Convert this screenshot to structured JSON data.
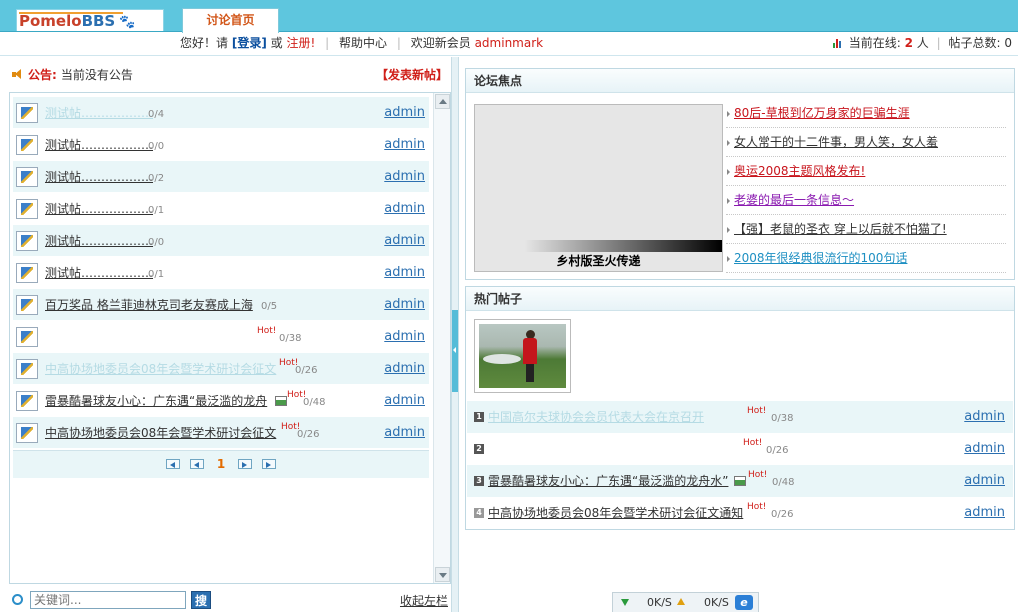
{
  "header": {
    "logo_a": "Pomelo",
    "logo_b": "BBS",
    "active_tab": "讨论首页"
  },
  "nav": {
    "greeting": "您好！请",
    "login": "[登录]",
    "or": "或",
    "register": "注册!",
    "help": "帮助中心",
    "welcome": "欢迎新会员",
    "new_member": "adminmark",
    "online_label": "当前在线:",
    "online_count": "2",
    "online_unit": "人",
    "total_label": "帖子总数:",
    "total_count": "0"
  },
  "notice": {
    "label": "公告:",
    "text": "当前没有公告",
    "post_button": "【发表新帖】"
  },
  "threads": [
    {
      "title": "测试帖………………",
      "count": "0/4",
      "hot": false,
      "author": "admin",
      "faded": true
    },
    {
      "title": "测试帖………………",
      "count": "0/0",
      "hot": false,
      "author": "admin",
      "faded": false
    },
    {
      "title": "测试帖………………",
      "count": "0/2",
      "hot": false,
      "author": "admin",
      "faded": false
    },
    {
      "title": "测试帖………………",
      "count": "0/1",
      "hot": false,
      "author": "admin",
      "faded": false
    },
    {
      "title": "测试帖………………",
      "count": "0/0",
      "hot": false,
      "author": "admin",
      "faded": false
    },
    {
      "title": "测试帖………………",
      "count": "0/1",
      "hot": false,
      "author": "admin",
      "faded": false
    },
    {
      "title": "百万奖品 格兰菲迪林克司老友赛成上海",
      "count": "0/5",
      "hot": false,
      "author": "admin",
      "faded": false
    },
    {
      "title": "",
      "count": "0/38",
      "hot": true,
      "author": "admin",
      "faded": false
    },
    {
      "title": "中高协场地委员会08年会暨学术研讨会征文",
      "count": "0/26",
      "hot": true,
      "author": "admin",
      "faded": true
    },
    {
      "title": "雷暴酷暑球友小心：广东遇“最泛滥的龙舟",
      "count": "0/48",
      "hot": true,
      "author": "admin",
      "faded": false,
      "image": true
    },
    {
      "title": "中高协场地委员会08年会暨学术研讨会征文",
      "count": "0/26",
      "hot": true,
      "author": "admin",
      "faded": false
    }
  ],
  "pager": {
    "current": "1"
  },
  "hot_label": "Hot!",
  "search": {
    "placeholder": "关键词...",
    "button": "搜",
    "collapse": "收起左栏"
  },
  "focus": {
    "title": "论坛焦点",
    "slide_caption": "乡村版圣火传递",
    "items": [
      {
        "text": "80后-草根到亿万身家的巨骗生涯",
        "color": "#c8141c"
      },
      {
        "text": "女人常干的十二件事，男人笑，女人羞",
        "color": "#333333"
      },
      {
        "text": "奥运2008主题风格发布!",
        "color": "#c8141c"
      },
      {
        "text": "老婆的最后一条信息～",
        "color": "#8a1ab0"
      },
      {
        "text": "【强】老鼠的圣衣 穿上以后就不怕猫了!",
        "color": "#333333"
      },
      {
        "text": "2008年很经典很流行的100句话",
        "color": "#1d8fc2"
      }
    ]
  },
  "hot": {
    "title": "热门帖子",
    "items": [
      {
        "num": "1",
        "title": "中国高尔夫球协会会员代表大会在京召开",
        "count": "0/38",
        "author": "admin",
        "faded": true
      },
      {
        "num": "2",
        "title": "",
        "count": "0/26",
        "author": "admin",
        "faded": false
      },
      {
        "num": "3",
        "title": "雷暴酷暑球友小心：广东遇“最泛滥的龙舟水”",
        "count": "0/48",
        "author": "admin",
        "faded": false,
        "image": true
      },
      {
        "num": "4",
        "title": "中高协场地委员会08年会暨学术研讨会征文通知",
        "count": "0/26",
        "author": "admin",
        "faded": false
      }
    ]
  },
  "status": {
    "down": "0K/S",
    "up": "0K/S"
  }
}
